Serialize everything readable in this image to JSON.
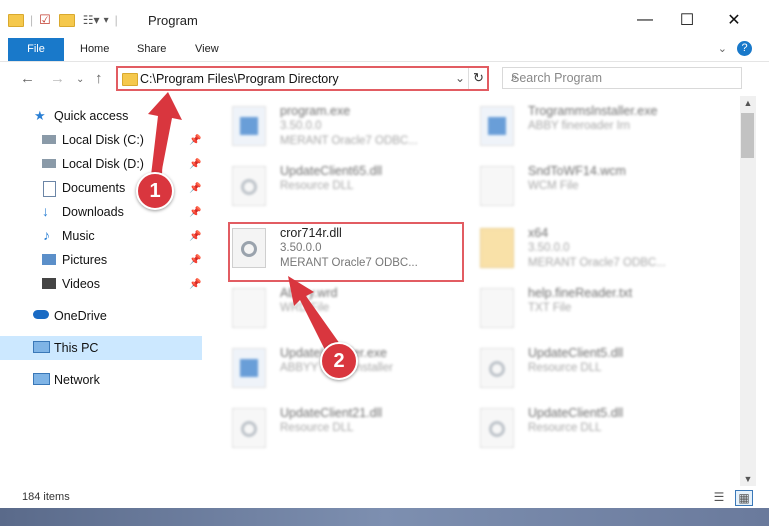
{
  "window": {
    "title": "Program",
    "minimize": "—",
    "maximize": "☐",
    "close": "✕"
  },
  "ribbon": {
    "tabs": [
      "File",
      "Home",
      "Share",
      "View"
    ],
    "help": "?"
  },
  "address": {
    "path": "C:\\Program Files\\Program Directory",
    "search_placeholder": "Search Program"
  },
  "sidebar": {
    "items": [
      {
        "label": "Quick access",
        "icon": "star-icon"
      },
      {
        "label": "Local Disk (C:)",
        "icon": "drive-icon",
        "pinned": true
      },
      {
        "label": "Local Disk (D:)",
        "icon": "drive-icon",
        "pinned": true
      },
      {
        "label": "Documents",
        "icon": "documents-icon",
        "pinned": true
      },
      {
        "label": "Downloads",
        "icon": "download-icon",
        "pinned": true
      },
      {
        "label": "Music",
        "icon": "music-icon",
        "pinned": true
      },
      {
        "label": "Pictures",
        "icon": "pictures-icon",
        "pinned": true
      },
      {
        "label": "Videos",
        "icon": "videos-icon",
        "pinned": true
      },
      {
        "label": "OneDrive",
        "icon": "cloud-icon"
      },
      {
        "label": "This PC",
        "icon": "computer-icon",
        "selected": true
      },
      {
        "label": "Network",
        "icon": "network-icon"
      }
    ]
  },
  "files": [
    {
      "name": "program.exe",
      "line2": "3.50.0.0",
      "line3": "MERANT Oracle7 ODBC...",
      "type": "exe",
      "blurred": true
    },
    {
      "name": "Trogrammslnstaller.exe",
      "line2": "ABBY fineroader Irn",
      "line3": "",
      "type": "exe",
      "blurred": true
    },
    {
      "name": "UpdateClient65.dll",
      "line2": "Resource DLL",
      "line3": "",
      "type": "dll",
      "blurred": true
    },
    {
      "name": "SndToWF14.wcm",
      "line2": "WCM File",
      "line3": "",
      "type": "file",
      "blurred": true
    },
    {
      "name": "cror714r.dll",
      "line2": "3.50.0.0",
      "line3": "MERANT Oracle7 ODBC...",
      "type": "dll",
      "blurred": false
    },
    {
      "name": "x64",
      "line2": "3.50.0.0",
      "line3": "MERANT Oracle7 ODBC...",
      "type": "folder",
      "blurred": true
    },
    {
      "name": "Abbyy.wrd",
      "line2": "WRD File",
      "line3": "",
      "type": "file",
      "blurred": true
    },
    {
      "name": "help.fineReader.txt",
      "line2": "TXT File",
      "line3": "",
      "type": "file",
      "blurred": true
    },
    {
      "name": "UpdateInstaller.exe",
      "line2": "ABBYY Basic Installer",
      "line3": "",
      "type": "exe",
      "blurred": true
    },
    {
      "name": "UpdateClient5.dll",
      "line2": "Resource DLL",
      "line3": "",
      "type": "dll",
      "blurred": true
    },
    {
      "name": "UpdateClient21.dll",
      "line2": "Resource DLL",
      "line3": "",
      "type": "dll",
      "blurred": true
    },
    {
      "name": "UpdateClient5.dll",
      "line2": "Resource DLL",
      "line3": "",
      "type": "dll",
      "blurred": true
    }
  ],
  "annotations": {
    "step1": "1",
    "step2": "2",
    "color": "#d9363e"
  },
  "status": {
    "count": "184 items"
  }
}
